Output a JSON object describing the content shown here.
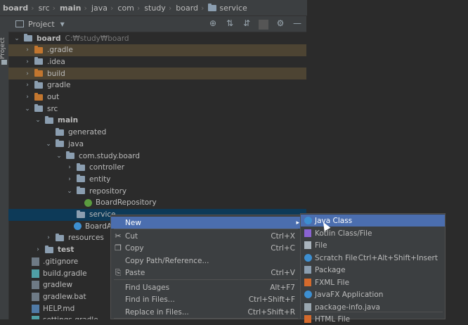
{
  "breadcrumb": [
    "board",
    "src",
    "main",
    "java",
    "com",
    "study",
    "board",
    "service"
  ],
  "side_stripe_label": "Project",
  "panel": {
    "title": "Project"
  },
  "tree": [
    {
      "label": "board",
      "path": "C:₩study₩board",
      "bold": true,
      "arrow": "v",
      "icon": "folder",
      "level": 0
    },
    {
      "label": ".gradle",
      "arrow": ">",
      "icon": "folder-orange",
      "level": 1,
      "excluded": true
    },
    {
      "label": ".idea",
      "arrow": ">",
      "icon": "folder",
      "level": 1
    },
    {
      "label": "build",
      "arrow": ">",
      "icon": "folder-orange",
      "level": 1,
      "excluded": true
    },
    {
      "label": "gradle",
      "arrow": ">",
      "icon": "folder",
      "level": 1
    },
    {
      "label": "out",
      "arrow": ">",
      "icon": "folder-orange",
      "level": 1
    },
    {
      "label": "src",
      "arrow": "v",
      "icon": "folder",
      "level": 1
    },
    {
      "label": "main",
      "bold": true,
      "arrow": "v",
      "icon": "folder",
      "level": 2
    },
    {
      "label": "generated",
      "arrow": "",
      "icon": "folder",
      "level": 3
    },
    {
      "label": "java",
      "arrow": "v",
      "icon": "folder",
      "level": 3
    },
    {
      "label": "com.study.board",
      "arrow": "v",
      "icon": "package",
      "level": 4
    },
    {
      "label": "controller",
      "arrow": ">",
      "icon": "package",
      "level": 5
    },
    {
      "label": "entity",
      "arrow": ">",
      "icon": "package",
      "level": 5
    },
    {
      "label": "repository",
      "arrow": "v",
      "icon": "package",
      "level": 5
    },
    {
      "label": "BoardRepository",
      "arrow": "",
      "icon": "interface",
      "level": 6
    },
    {
      "label": "service",
      "arrow": "",
      "icon": "package",
      "level": 5,
      "selected": true
    },
    {
      "label": "BoardA",
      "arrow": "",
      "icon": "class",
      "level": 5
    },
    {
      "label": "resources",
      "arrow": ">",
      "icon": "folder",
      "level": 3
    },
    {
      "label": "test",
      "bold": true,
      "arrow": ">",
      "icon": "folder",
      "level": 2
    },
    {
      "label": ".gitignore",
      "arrow": "",
      "icon": "file",
      "level": 1
    },
    {
      "label": "build.gradle",
      "arrow": "",
      "icon": "gradle",
      "level": 1
    },
    {
      "label": "gradlew",
      "arrow": "",
      "icon": "file",
      "level": 1
    },
    {
      "label": "gradlew.bat",
      "arrow": "",
      "icon": "file",
      "level": 1
    },
    {
      "label": "HELP.md",
      "arrow": "",
      "icon": "md",
      "level": 1
    },
    {
      "label": "settings.gradle",
      "arrow": "",
      "icon": "gradle",
      "level": 1
    }
  ],
  "context_menu": [
    {
      "label": "New",
      "shortcut": "",
      "submenu": true,
      "highlighted": true,
      "icon": ""
    },
    {
      "label": "Cut",
      "shortcut": "Ctrl+X",
      "icon": "cut-icon"
    },
    {
      "label": "Copy",
      "shortcut": "Ctrl+C",
      "icon": "copy-icon"
    },
    {
      "label": "Copy Path/Reference...",
      "shortcut": "",
      "icon": ""
    },
    {
      "label": "Paste",
      "shortcut": "Ctrl+V",
      "icon": "paste-icon"
    },
    {
      "label": "Find Usages",
      "shortcut": "Alt+F7",
      "icon": ""
    },
    {
      "label": "Find in Files...",
      "shortcut": "Ctrl+Shift+F",
      "icon": ""
    },
    {
      "label": "Replace in Files...",
      "shortcut": "Ctrl+Shift+R",
      "icon": ""
    }
  ],
  "new_submenu": [
    {
      "label": "Java Class",
      "shortcut": "",
      "icon": "java-class-icon",
      "color": "#3d8fd1",
      "highlighted": true
    },
    {
      "label": "Kotlin Class/File",
      "shortcut": "",
      "icon": "kotlin-icon",
      "color": "#8a63d2"
    },
    {
      "label": "File",
      "shortcut": "",
      "icon": "file-icon",
      "color": "#aab4bd"
    },
    {
      "label": "Scratch File",
      "shortcut": "Ctrl+Alt+Shift+Insert",
      "icon": "scratch-file-icon",
      "color": "#3d8fd1"
    },
    {
      "label": "Package",
      "shortcut": "",
      "icon": "package-icon",
      "color": "#8b9eb0"
    },
    {
      "label": "FXML File",
      "shortcut": "",
      "icon": "fxml-icon",
      "color": "#d46a2c"
    },
    {
      "label": "JavaFX Application",
      "shortcut": "",
      "icon": "javafx-icon",
      "color": "#3d8fd1"
    },
    {
      "label": "package-info.java",
      "shortcut": "",
      "icon": "package-info-icon",
      "color": "#9aa7b0"
    },
    {
      "label": "HTML File",
      "shortcut": "",
      "icon": "html-icon",
      "color": "#d46a2c"
    }
  ]
}
